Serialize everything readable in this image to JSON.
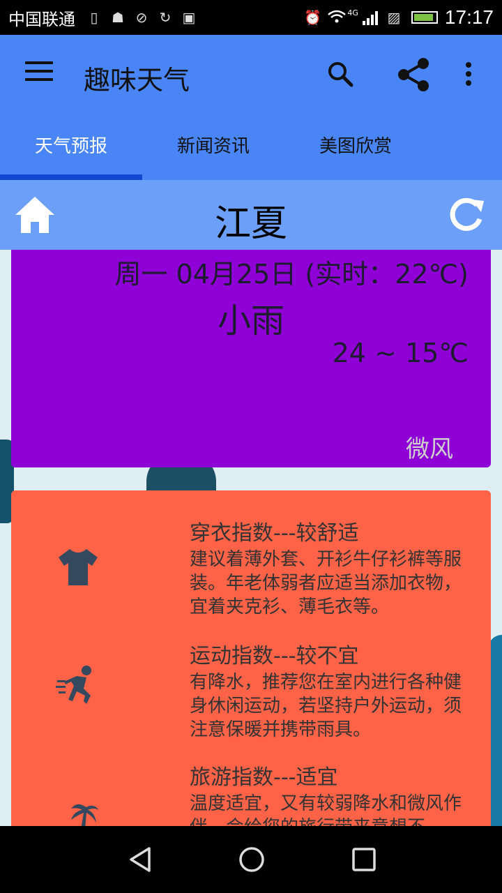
{
  "status_bar": {
    "carrier": "中国联通",
    "network": "4G",
    "time": "17:17"
  },
  "app_bar": {
    "title": "趣味天气",
    "icons": [
      "menu-icon",
      "search-icon",
      "share-icon",
      "more-icon"
    ]
  },
  "tabs": [
    {
      "label": "天气预报",
      "active": true
    },
    {
      "label": "新闻资讯",
      "active": false
    },
    {
      "label": "美图欣赏",
      "active": false
    }
  ],
  "city_header": {
    "city": "江夏",
    "left_icon": "home-icon",
    "right_icon": "refresh-icon"
  },
  "weather": {
    "date_line": "周一 04月25日 (实时：22℃)",
    "condition": "小雨",
    "temp_range": "24 ~ 15℃",
    "wind": "微风",
    "card_color": "#8e00d6"
  },
  "indices": [
    {
      "icon": "tshirt-icon",
      "title": "穿衣指数---较舒适",
      "desc": "建议着薄外套、开衫牛仔衫裤等服装。年老体弱者应适当添加衣物，宜着夹克衫、薄毛衣等。"
    },
    {
      "icon": "running-icon",
      "title": "运动指数---较不宜",
      "desc": "有降水，推荐您在室内进行各种健身休闲运动，若坚持户外运动，须注意保暖并携带雨具。"
    },
    {
      "icon": "palm-tree-icon",
      "title": "旅游指数---适宜",
      "desc": "温度适宜，又有较弱降水和微风作伴，会给您的旅行带来意想不"
    }
  ],
  "colors": {
    "app_bar": "#4a85f5",
    "city_header": "#6c9ff7",
    "index_card": "#ff6347"
  },
  "nav_bar": [
    "back-icon",
    "home-circle-icon",
    "recents-icon"
  ]
}
